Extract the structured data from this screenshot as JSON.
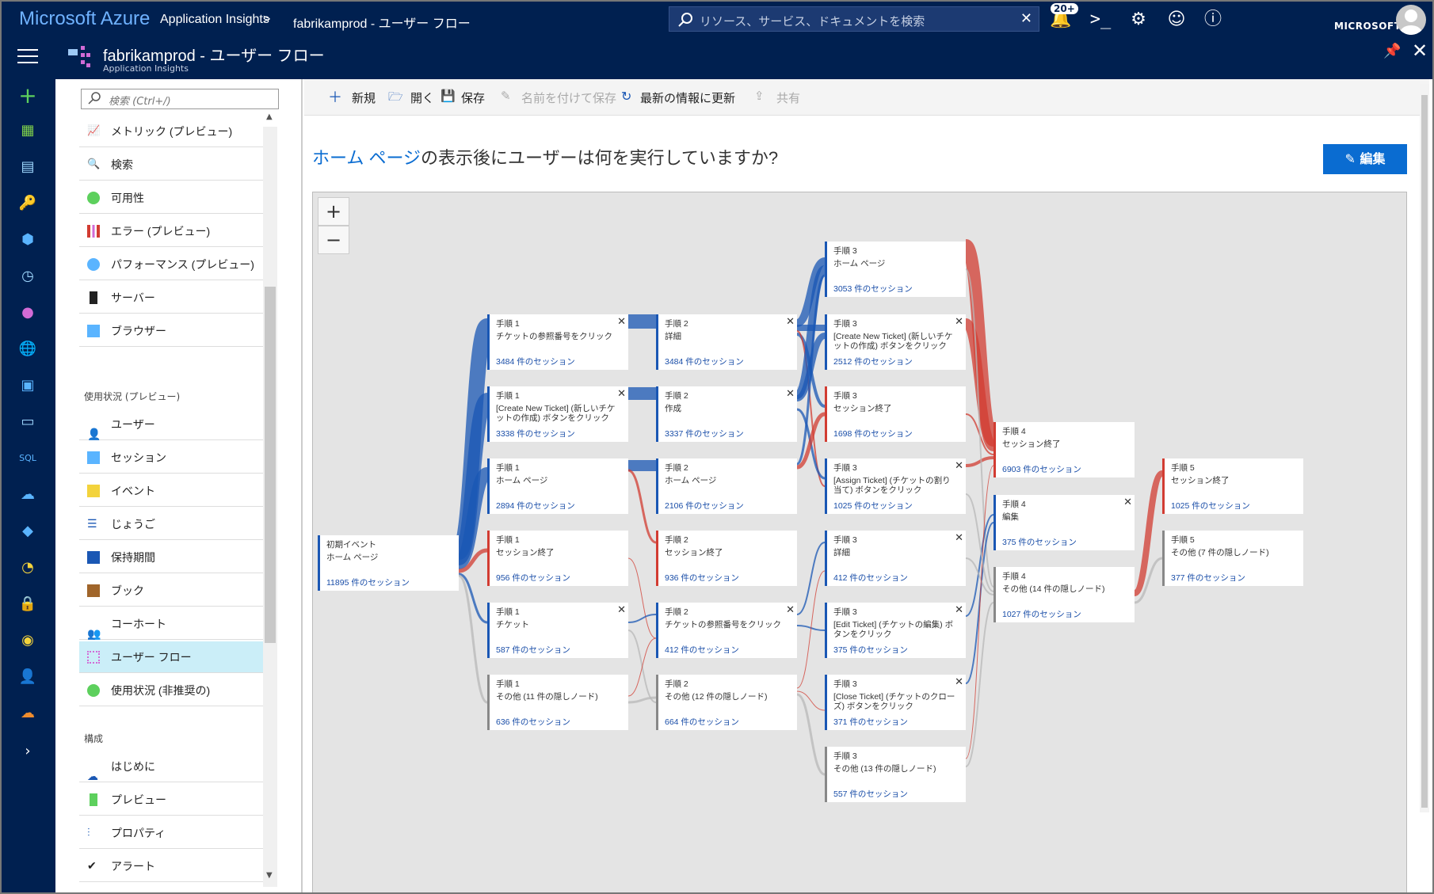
{
  "topbar": {
    "brand": "Microsoft Azure",
    "crumb1": "Application Insights",
    "crumb_sep": ">",
    "crumb2": "fabrikamprod - ユーザー フロー",
    "search_placeholder": "リソース、サービス、ドキュメントを検索",
    "notif_count": "20+",
    "account": "MICROSOFT"
  },
  "blade": {
    "title": "fabrikamprod - ユーザー フロー",
    "subtitle": "Application Insights"
  },
  "menu": {
    "search_placeholder": "検索 (Ctrl+/)",
    "items": [
      {
        "label": "メトリック (プレビュー)"
      },
      {
        "label": "検索"
      },
      {
        "label": "可用性"
      },
      {
        "label": "エラー (プレビュー)"
      },
      {
        "label": "パフォーマンス (プレビュー)"
      },
      {
        "label": "サーバー"
      },
      {
        "label": "ブラウザー"
      }
    ],
    "usage_section": "使用状況 (プレビュー)",
    "usage_items": [
      {
        "label": "ユーザー"
      },
      {
        "label": "セッション"
      },
      {
        "label": "イベント"
      },
      {
        "label": "じょうご"
      },
      {
        "label": "保持期間"
      },
      {
        "label": "ブック"
      },
      {
        "label": "コーホート"
      },
      {
        "label": "ユーザー フロー"
      },
      {
        "label": "使用状況 (非推奨の)"
      }
    ],
    "config_section": "構成",
    "config_items": [
      {
        "label": "はじめに"
      },
      {
        "label": "プレビュー"
      },
      {
        "label": "プロパティ"
      },
      {
        "label": "アラート"
      }
    ]
  },
  "toolbar": {
    "new": "新規",
    "open": "開く",
    "save": "保存",
    "save_as": "名前を付けて保存",
    "refresh": "最新の情報に更新",
    "share": "共有"
  },
  "question": {
    "highlight": "ホーム ページ",
    "rest": "の表示後にユーザーは何を実行していますか?"
  },
  "edit_label": "編集",
  "colors": {
    "blue": "#1a57b4",
    "red": "#d23c32",
    "gray": "#888888",
    "header": "#002050",
    "accent": "#0a6cd1"
  },
  "nodes": {
    "n0": {
      "step": "初期イベント",
      "label": "ホーム ページ",
      "count": "11895 件のセッション"
    },
    "s1a": {
      "step": "手順 1",
      "label": "チケットの参照番号をクリック",
      "count": "3484 件のセッション"
    },
    "s1b": {
      "step": "手順 1",
      "label": "[Create New Ticket] (新しいチケットの作成) ボタンをクリック",
      "count": "3338 件のセッション"
    },
    "s1c": {
      "step": "手順 1",
      "label": "ホーム ページ",
      "count": "2894 件のセッション"
    },
    "s1d": {
      "step": "手順 1",
      "label": "セッション終了",
      "count": "956 件のセッション"
    },
    "s1e": {
      "step": "手順 1",
      "label": "チケット",
      "count": "587 件のセッション"
    },
    "s1f": {
      "step": "手順 1",
      "label": "その他 (11 件の隠しノード)",
      "count": "636 件のセッション"
    },
    "s2a": {
      "step": "手順 2",
      "label": "詳細",
      "count": "3484 件のセッション"
    },
    "s2b": {
      "step": "手順 2",
      "label": "作成",
      "count": "3337 件のセッション"
    },
    "s2c": {
      "step": "手順 2",
      "label": "ホーム ページ",
      "count": "2106 件のセッション"
    },
    "s2d": {
      "step": "手順 2",
      "label": "セッション終了",
      "count": "936 件のセッション"
    },
    "s2e": {
      "step": "手順 2",
      "label": "チケットの参照番号をクリック",
      "count": "412 件のセッション"
    },
    "s2f": {
      "step": "手順 2",
      "label": "その他 (12 件の隠しノード)",
      "count": "664 件のセッション"
    },
    "s3a": {
      "step": "手順 3",
      "label": "ホーム ページ",
      "count": "3053 件のセッション"
    },
    "s3b": {
      "step": "手順 3",
      "label": "[Create New Ticket] (新しいチケットの作成) ボタンをクリック",
      "count": "2512 件のセッション"
    },
    "s3c": {
      "step": "手順 3",
      "label": "セッション終了",
      "count": "1698 件のセッション"
    },
    "s3d": {
      "step": "手順 3",
      "label": "[Assign Ticket] (チケットの割り当て) ボタンをクリック",
      "count": "1025 件のセッション"
    },
    "s3e": {
      "step": "手順 3",
      "label": "詳細",
      "count": "412 件のセッション"
    },
    "s3f": {
      "step": "手順 3",
      "label": "[Edit Ticket] (チケットの編集) ボタンをクリック",
      "count": "375 件のセッション"
    },
    "s3g": {
      "step": "手順 3",
      "label": "[Close Ticket] (チケットのクローズ) ボタンをクリック",
      "count": "371 件のセッション"
    },
    "s3h": {
      "step": "手順 3",
      "label": "その他 (13 件の隠しノード)",
      "count": "557 件のセッション"
    },
    "s4a": {
      "step": "手順 4",
      "label": "セッション終了",
      "count": "6903 件のセッション"
    },
    "s4b": {
      "step": "手順 4",
      "label": "編集",
      "count": "375 件のセッション"
    },
    "s4c": {
      "step": "手順 4",
      "label": "その他 (14 件の隠しノード)",
      "count": "1027 件のセッション"
    },
    "s5a": {
      "step": "手順 5",
      "label": "セッション終了",
      "count": "1025 件のセッション"
    },
    "s5b": {
      "step": "手順 5",
      "label": "その他 (7 件の隠しノード)",
      "count": "377 件のセッション"
    }
  }
}
